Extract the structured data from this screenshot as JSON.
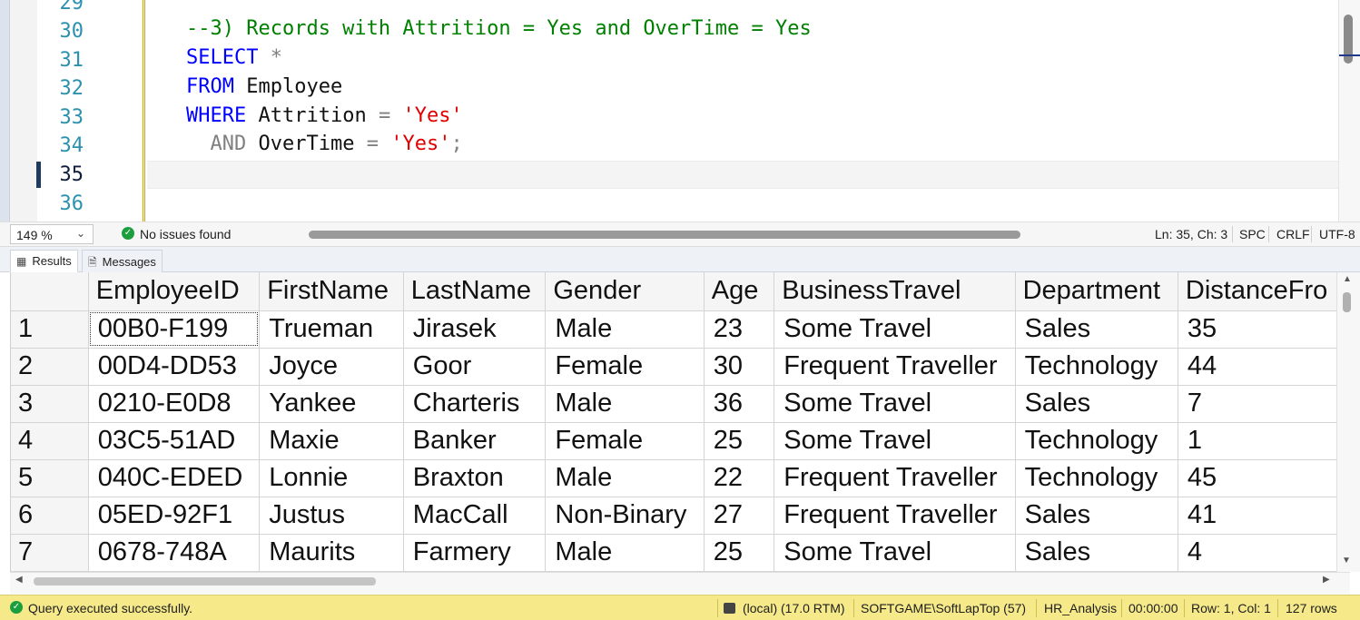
{
  "editor": {
    "line_numbers": [
      "29",
      "30",
      "31",
      "32",
      "33",
      "34",
      "35",
      "36"
    ],
    "current_line": "35",
    "code": {
      "line30": "--3) Records with Attrition = Yes and OverTime = Yes",
      "line31_kw": "SELECT",
      "line31_rest": "*",
      "line32_kw": "FROM",
      "line32_rest": "Employee",
      "line33_kw": "WHERE",
      "line33_col": "Attrition",
      "line33_op": "=",
      "line33_str": "'Yes'",
      "line34_kw": "AND",
      "line34_col": "OverTime",
      "line34_op": "=",
      "line34_str": "'Yes'",
      "line34_end": ";"
    }
  },
  "editor_status": {
    "zoom": "149 %",
    "issues": "No issues found",
    "position": "Ln: 35, Ch: 3",
    "whitespace": "SPC",
    "line_ending": "CRLF",
    "encoding": "UTF-8"
  },
  "tabs": {
    "results": "Results",
    "messages": "Messages"
  },
  "grid": {
    "columns": [
      "EmployeeID",
      "FirstName",
      "LastName",
      "Gender",
      "Age",
      "BusinessTravel",
      "Department",
      "DistanceFro"
    ],
    "rows": [
      {
        "num": "1",
        "cells": [
          "00B0-F199",
          "Trueman",
          "Jirasek",
          "Male",
          "23",
          "Some Travel",
          "Sales",
          "35"
        ]
      },
      {
        "num": "2",
        "cells": [
          "00D4-DD53",
          "Joyce",
          "Goor",
          "Female",
          "30",
          "Frequent Traveller",
          "Technology",
          "44"
        ]
      },
      {
        "num": "3",
        "cells": [
          "0210-E0D8",
          "Yankee",
          "Charteris",
          "Male",
          "36",
          "Some Travel",
          "Sales",
          "7"
        ]
      },
      {
        "num": "4",
        "cells": [
          "03C5-51AD",
          "Maxie",
          "Banker",
          "Female",
          "25",
          "Some Travel",
          "Technology",
          "1"
        ]
      },
      {
        "num": "5",
        "cells": [
          "040C-EDED",
          "Lonnie",
          "Braxton",
          "Male",
          "22",
          "Frequent Traveller",
          "Technology",
          "45"
        ]
      },
      {
        "num": "6",
        "cells": [
          "05ED-92F1",
          "Justus",
          "MacCall",
          "Non-Binary",
          "27",
          "Frequent Traveller",
          "Sales",
          "41"
        ]
      },
      {
        "num": "7",
        "cells": [
          "0678-748A",
          "Maurits",
          "Farmery",
          "Male",
          "25",
          "Some Travel",
          "Sales",
          "4"
        ]
      }
    ]
  },
  "query_status": {
    "message": "Query executed successfully.",
    "server": "(local) (17.0 RTM)",
    "login": "SOFTGAME\\SoftLapTop (57)",
    "database": "HR_Analysis",
    "elapsed": "00:00:00",
    "row_col": "Row: 1, Col: 1",
    "row_count": "127 rows"
  }
}
